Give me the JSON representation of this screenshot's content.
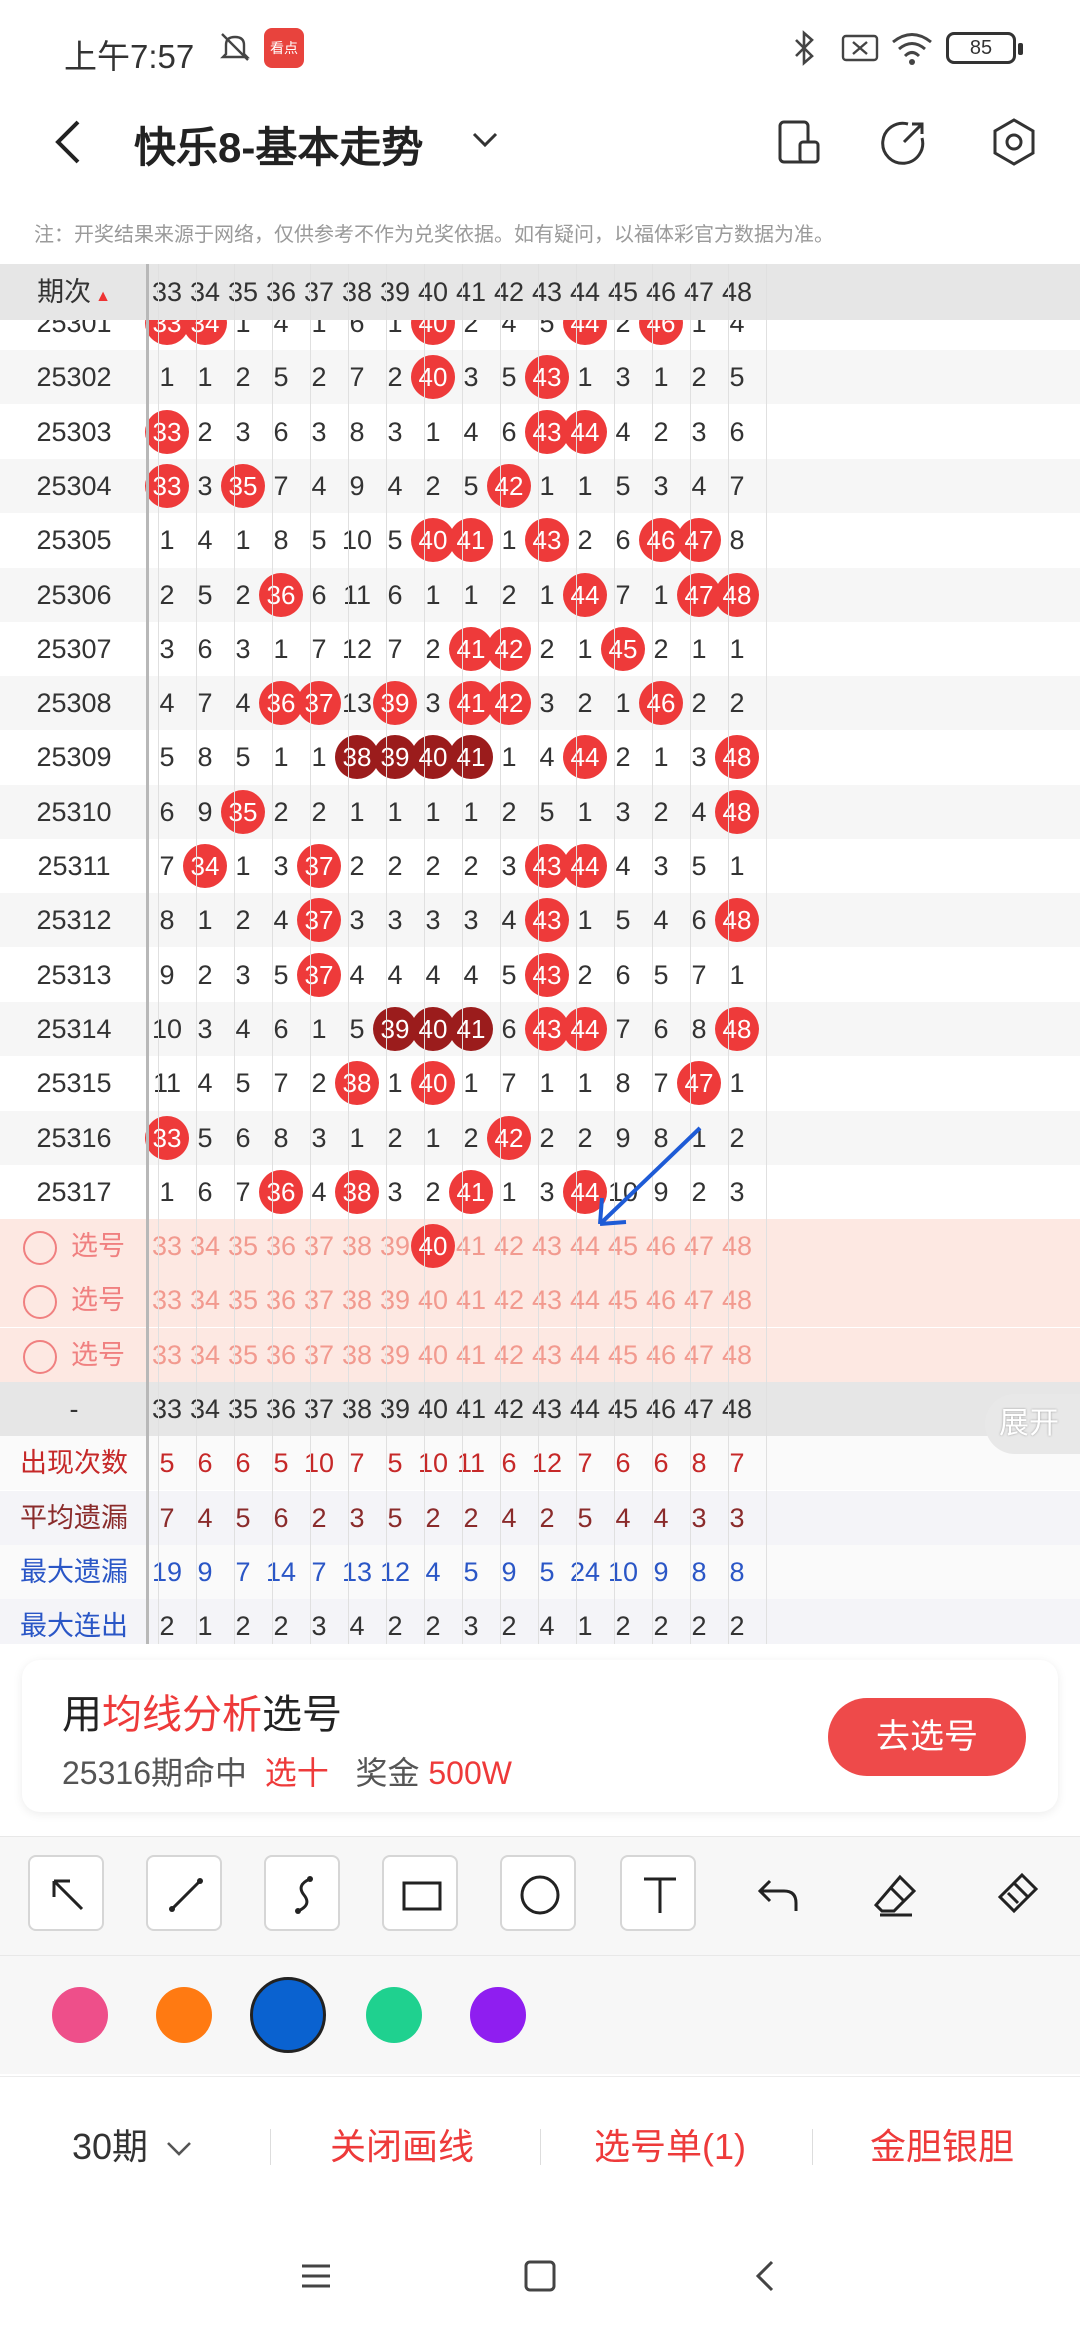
{
  "status_bar": {
    "time": "上午7:57",
    "app_icon_text": "看点",
    "battery": "85"
  },
  "header": {
    "title": "快乐8-基本走势",
    "icons": [
      "back-icon",
      "dropdown-icon",
      "screen-rotate-icon",
      "share-icon",
      "settings-icon"
    ]
  },
  "notice": "注：开奖结果来源于网络，仅供参考不作为兑奖依据。如有疑问，以福体彩官方数据为准。",
  "table": {
    "period_header": "期次",
    "columns": [
      "33",
      "34",
      "35",
      "36",
      "37",
      "38",
      "39",
      "40",
      "41",
      "42",
      "43",
      "44",
      "45",
      "46",
      "47",
      "48"
    ],
    "rows": [
      {
        "period": "25301",
        "cells": [
          "33",
          "34",
          "1",
          "4",
          "1",
          "6",
          "1",
          "40",
          "2",
          "4",
          "5",
          "44",
          "2",
          "46",
          "1",
          "4"
        ]
      },
      {
        "period": "25302",
        "cells": [
          "1",
          "1",
          "2",
          "5",
          "2",
          "7",
          "2",
          "40",
          "3",
          "5",
          "43",
          "1",
          "3",
          "1",
          "2",
          "5"
        ]
      },
      {
        "period": "25303",
        "cells": [
          "33",
          "2",
          "3",
          "6",
          "3",
          "8",
          "3",
          "1",
          "4",
          "6",
          "43",
          "44",
          "4",
          "2",
          "3",
          "6"
        ]
      },
      {
        "period": "25304",
        "cells": [
          "33",
          "3",
          "35",
          "7",
          "4",
          "9",
          "4",
          "2",
          "5",
          "42",
          "1",
          "1",
          "5",
          "3",
          "4",
          "7"
        ]
      },
      {
        "period": "25305",
        "cells": [
          "1",
          "4",
          "1",
          "8",
          "5",
          "10",
          "5",
          "40",
          "41",
          "1",
          "43",
          "2",
          "6",
          "46",
          "47",
          "8"
        ]
      },
      {
        "period": "25306",
        "cells": [
          "2",
          "5",
          "2",
          "36",
          "6",
          "11",
          "6",
          "1",
          "1",
          "2",
          "1",
          "44",
          "7",
          "1",
          "47",
          "48"
        ]
      },
      {
        "period": "25307",
        "cells": [
          "3",
          "6",
          "3",
          "1",
          "7",
          "12",
          "7",
          "2",
          "41",
          "42",
          "2",
          "1",
          "45",
          "2",
          "1",
          "1"
        ]
      },
      {
        "period": "25308",
        "cells": [
          "4",
          "7",
          "4",
          "36",
          "37",
          "13",
          "39",
          "3",
          "41",
          "42",
          "3",
          "2",
          "1",
          "46",
          "2",
          "2"
        ]
      },
      {
        "period": "25309",
        "cells": [
          "5",
          "8",
          "5",
          "1",
          "1",
          "38",
          "39",
          "40",
          "41",
          "1",
          "4",
          "44",
          "2",
          "1",
          "3",
          "48"
        ]
      },
      {
        "period": "25310",
        "cells": [
          "6",
          "9",
          "35",
          "2",
          "2",
          "1",
          "1",
          "1",
          "1",
          "2",
          "5",
          "1",
          "3",
          "2",
          "4",
          "48"
        ]
      },
      {
        "period": "25311",
        "cells": [
          "7",
          "34",
          "1",
          "3",
          "37",
          "2",
          "2",
          "2",
          "2",
          "3",
          "43",
          "44",
          "4",
          "3",
          "5",
          "1"
        ]
      },
      {
        "period": "25312",
        "cells": [
          "8",
          "1",
          "2",
          "4",
          "37",
          "3",
          "3",
          "3",
          "3",
          "4",
          "43",
          "1",
          "5",
          "4",
          "6",
          "48"
        ]
      },
      {
        "period": "25313",
        "cells": [
          "9",
          "2",
          "3",
          "5",
          "37",
          "4",
          "4",
          "4",
          "4",
          "5",
          "43",
          "2",
          "6",
          "5",
          "7",
          "1"
        ]
      },
      {
        "period": "25314",
        "cells": [
          "10",
          "3",
          "4",
          "6",
          "1",
          "5",
          "39",
          "40",
          "41",
          "6",
          "43",
          "44",
          "7",
          "6",
          "8",
          "48"
        ]
      },
      {
        "period": "25315",
        "cells": [
          "11",
          "4",
          "5",
          "7",
          "2",
          "38",
          "1",
          "40",
          "1",
          "7",
          "1",
          "1",
          "8",
          "7",
          "47",
          "1"
        ]
      },
      {
        "period": "25316",
        "cells": [
          "33",
          "5",
          "6",
          "8",
          "3",
          "1",
          "2",
          "1",
          "2",
          "42",
          "2",
          "2",
          "9",
          "8",
          "1",
          "2"
        ]
      },
      {
        "period": "25317",
        "cells": [
          "1",
          "6",
          "7",
          "36",
          "4",
          "38",
          "3",
          "2",
          "41",
          "1",
          "3",
          "44",
          "10",
          "9",
          "2",
          "3"
        ]
      }
    ],
    "pick_rows": [
      {
        "label": "选号",
        "selected": [
          "40"
        ]
      },
      {
        "label": "选号",
        "selected": []
      },
      {
        "label": "选号",
        "selected": []
      }
    ],
    "footer_label": "-",
    "stats": [
      {
        "label": "出现次数",
        "values": [
          "5",
          "6",
          "6",
          "5",
          "10",
          "7",
          "5",
          "10",
          "11",
          "6",
          "12",
          "7",
          "6",
          "6",
          "8",
          "7"
        ]
      },
      {
        "label": "平均遗漏",
        "values": [
          "7",
          "4",
          "5",
          "6",
          "2",
          "3",
          "5",
          "2",
          "2",
          "4",
          "2",
          "5",
          "4",
          "4",
          "3",
          "3"
        ]
      },
      {
        "label": "最大遗漏",
        "values": [
          "19",
          "9",
          "7",
          "14",
          "7",
          "13",
          "12",
          "4",
          "5",
          "9",
          "5",
          "24",
          "10",
          "9",
          "8",
          "8"
        ]
      },
      {
        "label": "最大连出",
        "values": [
          "2",
          "1",
          "2",
          "2",
          "3",
          "4",
          "2",
          "2",
          "3",
          "2",
          "4",
          "1",
          "2",
          "2",
          "2",
          "2"
        ]
      }
    ],
    "expand_label": "展开"
  },
  "promo": {
    "line1_pre": "用",
    "line1_highlight": "均线分析",
    "line1_post": "选号",
    "line2_period": "25316期命中",
    "line2_type": "选十",
    "line2_prize_label": "奖金",
    "line2_prize": "500W",
    "button": "去选号"
  },
  "draw_tools": [
    "arrow-tool-icon",
    "line-tool-icon",
    "curve-tool-icon",
    "rectangle-tool-icon",
    "circle-tool-icon",
    "text-tool-icon",
    "undo-icon",
    "eraser-icon",
    "clear-brush-icon"
  ],
  "colors": [
    "#ee4f8a",
    "#ff7a12",
    "#0a62d0",
    "#1fd18f",
    "#8f1ef0"
  ],
  "selected_color": "#0a62d0",
  "actions": {
    "period": "30期",
    "close_draw": "关闭画线",
    "pick_list": "选号单(1)",
    "gold_silver": "金胆银胆"
  }
}
